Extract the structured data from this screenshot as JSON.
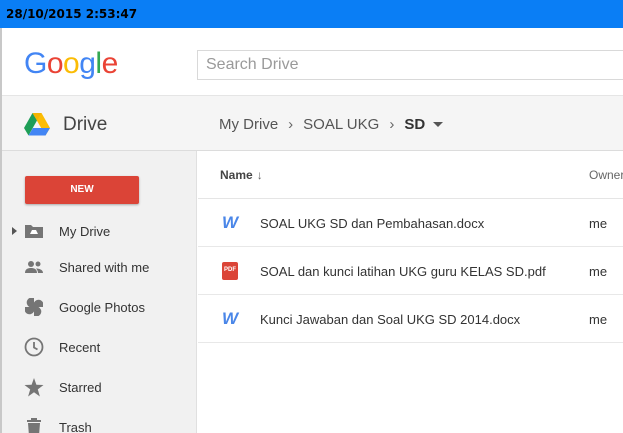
{
  "titlebar": {
    "timestamp": "28/10/2015 2:53:47"
  },
  "header": {
    "logo_letters": [
      {
        "ch": "G",
        "color": "#4285f4"
      },
      {
        "ch": "o",
        "color": "#ea4335"
      },
      {
        "ch": "o",
        "color": "#fbbc05"
      },
      {
        "ch": "g",
        "color": "#4285f4"
      },
      {
        "ch": "l",
        "color": "#34a853"
      },
      {
        "ch": "e",
        "color": "#ea4335"
      }
    ],
    "search_placeholder": "Search Drive"
  },
  "toolbar": {
    "app_name": "Drive",
    "breadcrumb": [
      "My Drive",
      "SOAL UKG",
      "SD"
    ]
  },
  "sidebar": {
    "new_label": "NEW",
    "items": [
      {
        "label": "My Drive",
        "icon": "my-drive-icon"
      },
      {
        "label": "Shared with me",
        "icon": "shared-icon"
      },
      {
        "label": "Google Photos",
        "icon": "photos-icon"
      },
      {
        "label": "Recent",
        "icon": "clock-icon"
      },
      {
        "label": "Starred",
        "icon": "star-icon"
      },
      {
        "label": "Trash",
        "icon": "trash-icon"
      }
    ]
  },
  "files": {
    "col_name": "Name",
    "sort_glyph": "↓",
    "col_owner": "Owner",
    "rows": [
      {
        "name": "SOAL UKG SD dan Pembahasan.docx",
        "owner": "me",
        "type": "word-icon"
      },
      {
        "name": "SOAL dan kunci latihan UKG guru KELAS SD.pdf",
        "owner": "me",
        "type": "pdf-icon"
      },
      {
        "name": "Kunci Jawaban dan Soal UKG SD 2014.docx",
        "owner": "me",
        "type": "word-icon"
      }
    ]
  },
  "colors": {
    "titlebar": "#0a7ef5",
    "new_button": "#db4437",
    "word": "#4a86e8",
    "pdf": "#db4437"
  },
  "icon_text": {
    "word": "W",
    "pdf": "PDF"
  }
}
